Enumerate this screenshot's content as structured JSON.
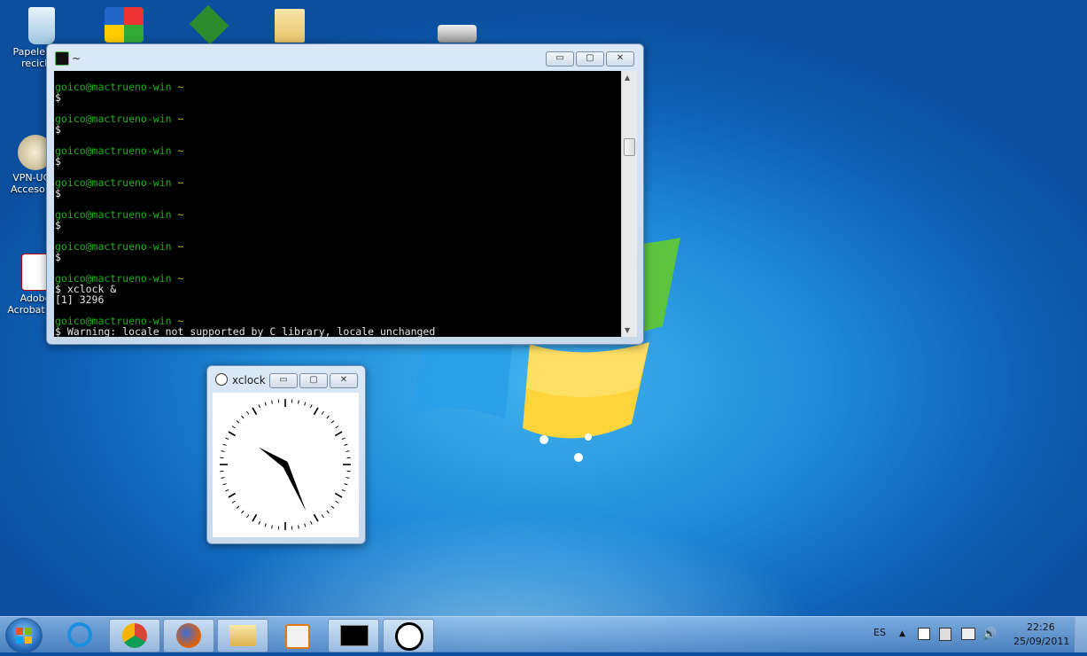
{
  "desktop": {
    "icons": [
      {
        "label": "Papelera de reciclaje"
      },
      {
        "label": "VPN-UCM Acceso de"
      },
      {
        "label": "Adobe Acrobat Pro"
      }
    ],
    "top_icons": [
      "AVG",
      "gVim",
      "Folder",
      "Network drive"
    ]
  },
  "terminal": {
    "title": "~",
    "prompt_user": "goico@mactrueno-win",
    "prompt_path": "~",
    "lines": [
      {
        "user": "goico@mactrueno-win",
        "path": "~",
        "cmd": "$"
      },
      {
        "user": "goico@mactrueno-win",
        "path": "~",
        "cmd": "$"
      },
      {
        "user": "goico@mactrueno-win",
        "path": "~",
        "cmd": "$"
      },
      {
        "user": "goico@mactrueno-win",
        "path": "~",
        "cmd": "$"
      },
      {
        "user": "goico@mactrueno-win",
        "path": "~",
        "cmd": "$"
      },
      {
        "user": "goico@mactrueno-win",
        "path": "~",
        "cmd": "$"
      }
    ],
    "xclock_prompt": "goico@mactrueno-win",
    "xclock_cmd": "$ xclock &",
    "job_line": "[1] 3296",
    "last_prompt": "goico@mactrueno-win",
    "warning": "$ Warning: locale not supported by C library, locale unchanged"
  },
  "xclock": {
    "title": "xclock",
    "hour_hand": 10.1,
    "minute_hand": 26
  },
  "window_controls": {
    "minimize": "▭",
    "maximize": "▢",
    "close": "✕"
  },
  "taskbar": {
    "items": [
      "Internet Explorer",
      "Google Chrome",
      "Firefox",
      "Windows Explorer",
      "Media Player",
      "Terminal",
      "xclock"
    ],
    "language": "ES",
    "time": "22:26",
    "date": "25/09/2011"
  },
  "colors": {
    "prompt_green": "#19b219",
    "path_yellow": "#c9b51b"
  }
}
